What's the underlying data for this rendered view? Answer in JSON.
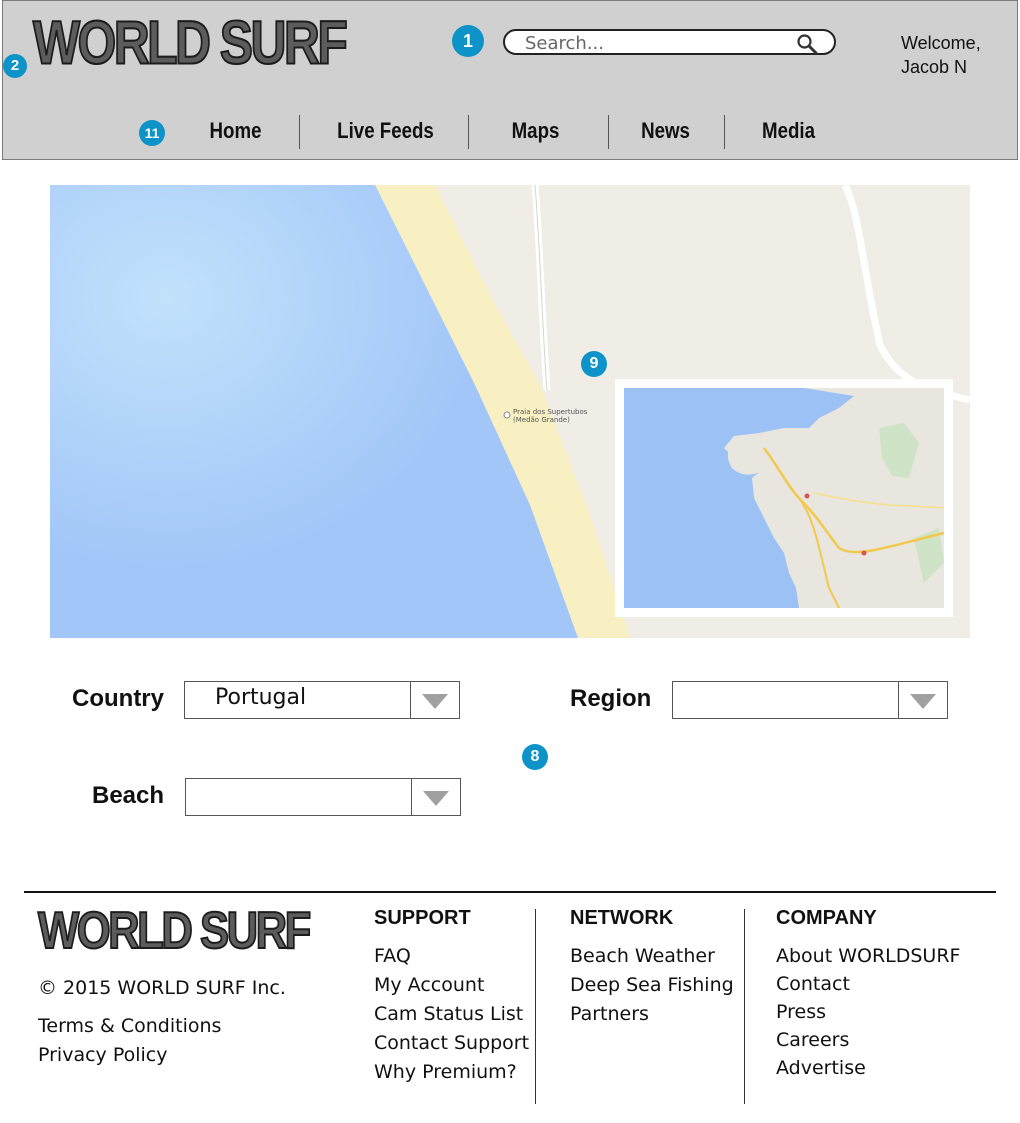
{
  "header": {
    "logo": "WORLD SURF",
    "search": {
      "placeholder": "Search...",
      "value": ""
    },
    "welcome": {
      "line1": "Welcome,",
      "line2": "Jacob N"
    },
    "markers": {
      "search": "1",
      "logo": "2",
      "nav": "11"
    },
    "nav": {
      "home": "Home",
      "live_feeds": "Live Feeds",
      "maps": "Maps",
      "news": "News",
      "media": "Media"
    }
  },
  "map": {
    "marker": "9",
    "place_label_line1": "Praia dos Supertubos",
    "place_label_line2": "(Medão Grande)",
    "colors": {
      "ocean": "#a4c8f8",
      "sand": "#f8f0c2",
      "land": "#efede6"
    }
  },
  "form": {
    "marker": "8",
    "country": {
      "label": "Country",
      "value": "Portugal"
    },
    "region": {
      "label": "Region",
      "value": ""
    },
    "beach": {
      "label": "Beach",
      "value": ""
    }
  },
  "footer": {
    "logo": "WORLD SURF",
    "copyright": "© 2015 WORLD SURF Inc.",
    "terms": "Terms & Conditions",
    "privacy": "Privacy Policy",
    "support": {
      "heading": "SUPPORT",
      "links": [
        "FAQ",
        "My Account",
        "Cam Status List",
        "Contact Support",
        "Why Premium?"
      ]
    },
    "network": {
      "heading": "NETWORK",
      "links": [
        "Beach Weather",
        "Deep Sea Fishing",
        "Partners"
      ]
    },
    "company": {
      "heading": "COMPANY",
      "links": [
        "About WORLDSURF",
        "Contact",
        "Press",
        "Careers",
        "Advertise"
      ]
    }
  },
  "colors": {
    "accent": "#0d93c8",
    "header_bg": "#d0d0d0"
  }
}
